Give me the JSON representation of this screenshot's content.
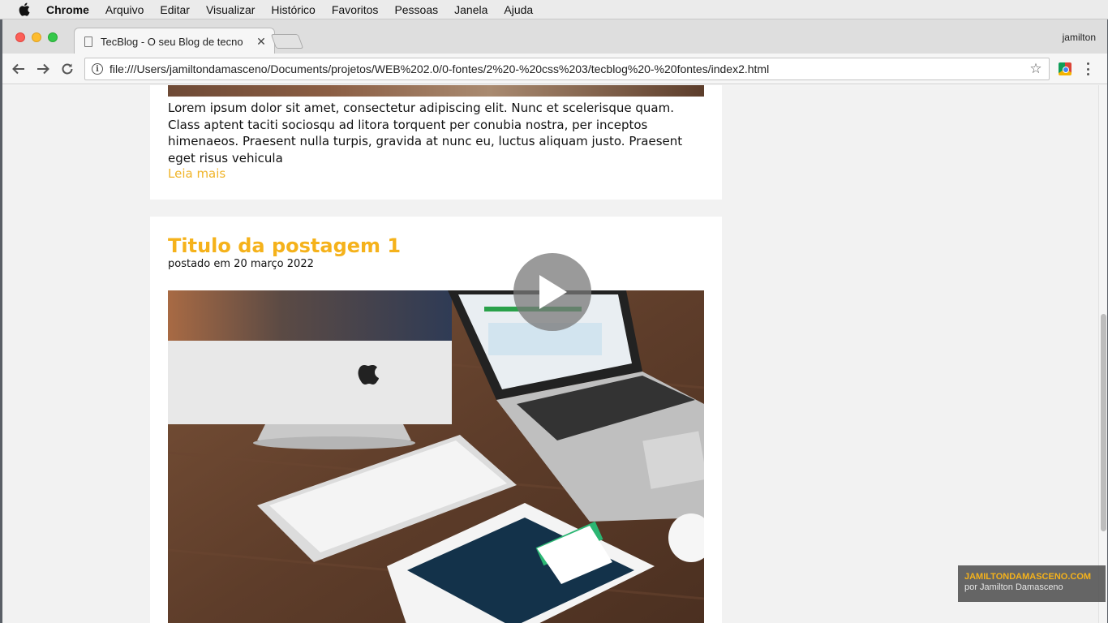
{
  "menubar": {
    "app_name": "Chrome",
    "items": [
      "Arquivo",
      "Editar",
      "Visualizar",
      "Histórico",
      "Favoritos",
      "Pessoas",
      "Janela",
      "Ajuda"
    ]
  },
  "browser": {
    "tab_title": "TecBlog - O seu Blog de tecno",
    "profile_name": "jamilton",
    "url": "file:///Users/jamiltondamasceno/Documents/projetos/WEB%202.0/0-fontes/2%20-%20css%203/tecblog%20-%20fontes/index2.html"
  },
  "page": {
    "post_previous": {
      "excerpt": "Lorem ipsum dolor sit amet, consectetur adipiscing elit. Nunc et scelerisque quam. Class aptent taciti sociosqu ad litora torquent per conubia nostra, per inceptos himenaeos. Praesent nulla turpis, gravida at nunc eu, luctus aliquam justo. Praesent eget risus vehicula",
      "read_more": "Leia mais"
    },
    "post": {
      "title": "Titulo da postagem 1",
      "date": "postado em 20 março 2022"
    }
  },
  "watermark": {
    "site": "JAMILTONDAMASCENO.COM",
    "by": "por Jamilton Damasceno"
  },
  "colors": {
    "accent": "#f5b21b",
    "link": "#f0b429",
    "background": "#f2f2f2"
  },
  "icons": {
    "menubar": "apple-icon",
    "tab": "page-icon",
    "nav": [
      "back-arrow-icon",
      "forward-arrow-icon",
      "reload-icon"
    ],
    "omnibox": [
      "info-icon",
      "star-icon"
    ],
    "overlay": "play-icon"
  }
}
